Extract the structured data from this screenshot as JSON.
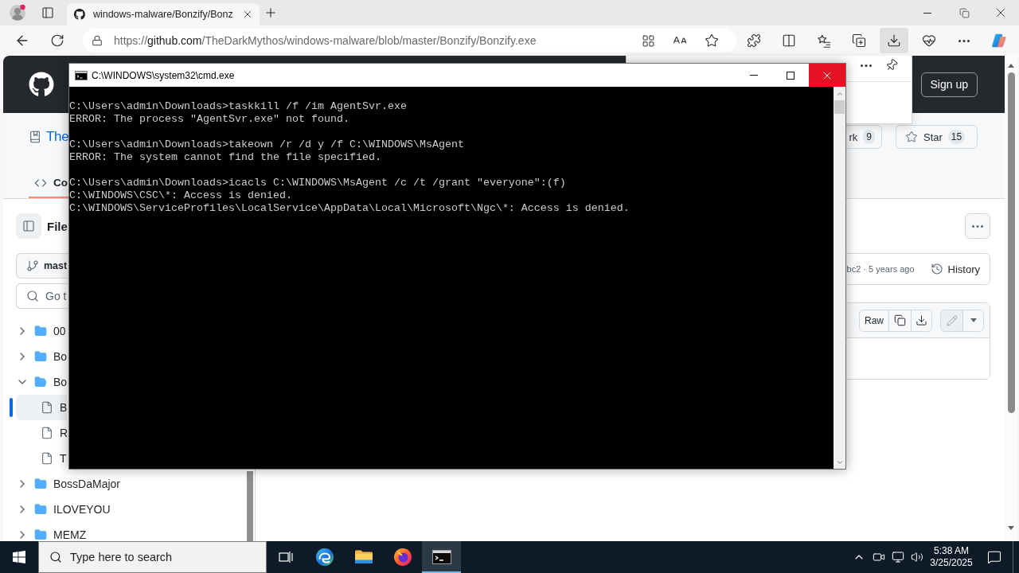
{
  "browser": {
    "tab": {
      "title": "windows-malware/Bonzify/Bonz",
      "selected": true
    },
    "address": {
      "scheme": "https://",
      "host": "github.com",
      "path": "/TheDarkMythos/windows-malware/blob/master/Bonzify/Bonzify.exe"
    },
    "toolbar": [
      {
        "kind": "extensions",
        "selected": false
      },
      {
        "kind": "split",
        "selected": false
      },
      {
        "kind": "favorites",
        "selected": false
      },
      {
        "kind": "collections",
        "selected": false
      },
      {
        "kind": "downloads",
        "selected": true
      },
      {
        "kind": "health",
        "selected": false
      },
      {
        "kind": "more",
        "selected": false
      },
      {
        "kind": "copilot",
        "selected": false
      }
    ]
  },
  "github": {
    "header": {
      "sign_up": "Sign up"
    },
    "repo": {
      "title": "The",
      "fork": {
        "label": "rk",
        "count": "9"
      },
      "star": {
        "label": "Star",
        "count": "15"
      }
    },
    "tabs": [
      {
        "label": "Co",
        "selected": true
      }
    ],
    "sidebar": {
      "title": "File",
      "branch": "mast",
      "search": {
        "placeholder": "Go t"
      },
      "tree": [
        {
          "name": "00",
          "kind": "folder",
          "expanded": false,
          "selected": false
        },
        {
          "name": "Bo",
          "kind": "folder",
          "expanded": false,
          "selected": false
        },
        {
          "name": "Bo",
          "kind": "folder",
          "expanded": true,
          "selected": false,
          "children": [
            {
              "name": "B",
              "kind": "file",
              "selected": true
            },
            {
              "name": "R",
              "kind": "file",
              "selected": false
            },
            {
              "name": "T",
              "kind": "file",
              "selected": false
            }
          ]
        },
        {
          "name": "BossDaMajor",
          "kind": "folder",
          "expanded": false,
          "selected": false
        },
        {
          "name": "ILOVEYOU",
          "kind": "folder",
          "expanded": false,
          "selected": false
        },
        {
          "name": "MEMZ",
          "kind": "folder",
          "expanded": false,
          "selected": false
        }
      ]
    },
    "commit": {
      "info": "bc2 · 5 years ago",
      "history": "History"
    },
    "file_actions": {
      "raw": "Raw"
    }
  },
  "console": {
    "title": "C:\\WINDOWS\\system32\\cmd.exe",
    "blocks": [
      {
        "command": "C:\\Users\\admin\\Downloads>taskkill /f /im AgentSvr.exe",
        "output": [
          "ERROR: The process \"AgentSvr.exe\" not found."
        ]
      },
      {
        "command": "C:\\Users\\admin\\Downloads>takeown /r /d y /f C:\\WINDOWS\\MsAgent",
        "output": [
          "ERROR: The system cannot find the file specified."
        ]
      },
      {
        "command": "C:\\Users\\admin\\Downloads>icacls C:\\WINDOWS\\MsAgent /c /t /grant \"everyone\":(f)",
        "output": [
          "C:\\WINDOWS\\CSC\\*: Access is denied.",
          "C:\\WINDOWS\\ServiceProfiles\\LocalService\\AppData\\Local\\Microsoft\\Ngc\\*: Access is denied."
        ]
      }
    ]
  },
  "taskbar": {
    "search": {
      "placeholder": "Type here to search"
    },
    "apps": [
      {
        "kind": "edge",
        "selected": false
      },
      {
        "kind": "explorer",
        "selected": false
      },
      {
        "kind": "firefox",
        "selected": false
      },
      {
        "kind": "cmd",
        "selected": true
      }
    ],
    "time": "5:38 AM",
    "date": "3/25/2025"
  }
}
